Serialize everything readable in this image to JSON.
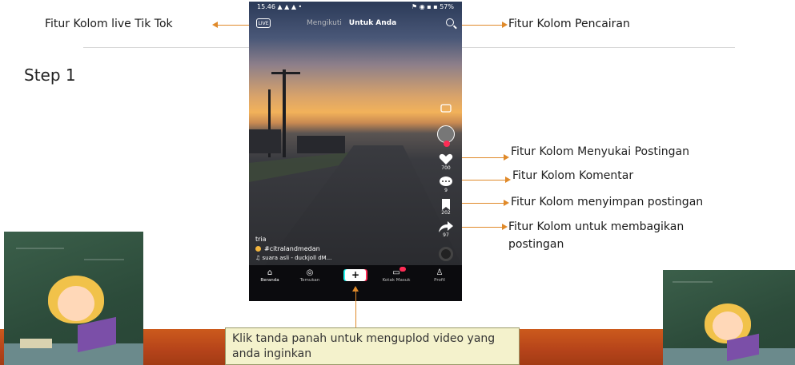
{
  "annotations": {
    "live": "Fitur Kolom live Tik Tok",
    "search": "Fitur Kolom Pencairan",
    "like": "Fitur Kolom Menyukai Postingan",
    "comment": "Fitur Kolom Komentar",
    "save": "Fitur Kolom menyimpan postingan",
    "share_line1": "Fitur Kolom untuk membagikan",
    "share_line2": "postingan"
  },
  "step_title": "Step 1",
  "callout": {
    "line1": "Klik tanda panah untuk menguplod video yang",
    "line2": "anda inginkan"
  },
  "phone": {
    "status_left": "15.46 ▲ ▲ ▲  •",
    "status_right": "⚑ ◉ ▪ ▪ 57%",
    "live_label": "LIVE",
    "tab_following": "Mengikuti",
    "tab_for_you": "Untuk Anda",
    "like_count": "700",
    "comment_count": "9",
    "save_count": "202",
    "share_count": "97",
    "caption_user": "tria",
    "caption_tag": "#citralandmedan",
    "caption_sound": "♫  suara asli - duckjoll dM...",
    "nav": {
      "home": "Beranda",
      "discover": "Temukan",
      "inbox": "Kotak Masuk",
      "profile": "Profil"
    }
  },
  "icons": {
    "like": "heart-icon",
    "comment": "comment-icon",
    "save": "bookmark-icon",
    "share": "share-arrow-icon",
    "search": "search-icon",
    "live": "live-tv-icon"
  },
  "colors": {
    "arrow": "#e08a2a",
    "band": "#b5431a",
    "callout_bg": "#f4f2cc"
  }
}
